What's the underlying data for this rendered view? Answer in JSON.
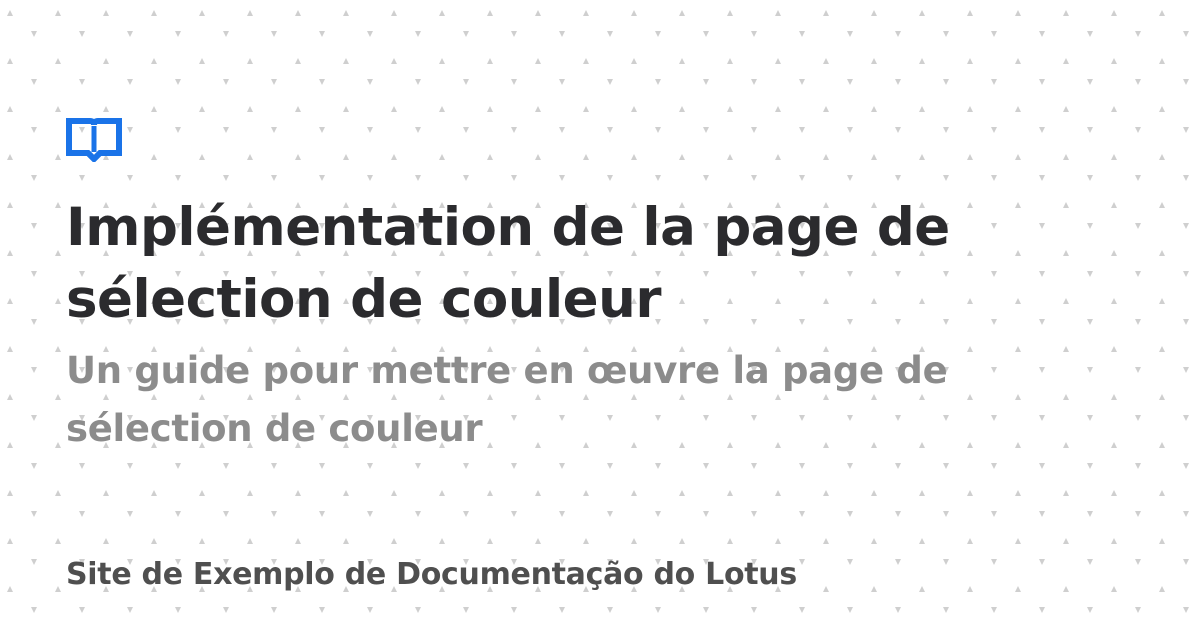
{
  "page": {
    "background_color": "#ffffff",
    "pattern_color": "#cfcfcf"
  },
  "logo": {
    "icon": "book-icon",
    "color": "#1a73e8"
  },
  "title": "Implémentation de la page de sélection de couleur",
  "subtitle": "Un guide pour mettre en œuvre la page de sélection de couleur",
  "site_name": "Site de Exemplo de Documentação do Lotus",
  "colors": {
    "title": "#2b2b2e",
    "subtitle": "#8c8c8c",
    "site_name": "#4f4f4f"
  }
}
